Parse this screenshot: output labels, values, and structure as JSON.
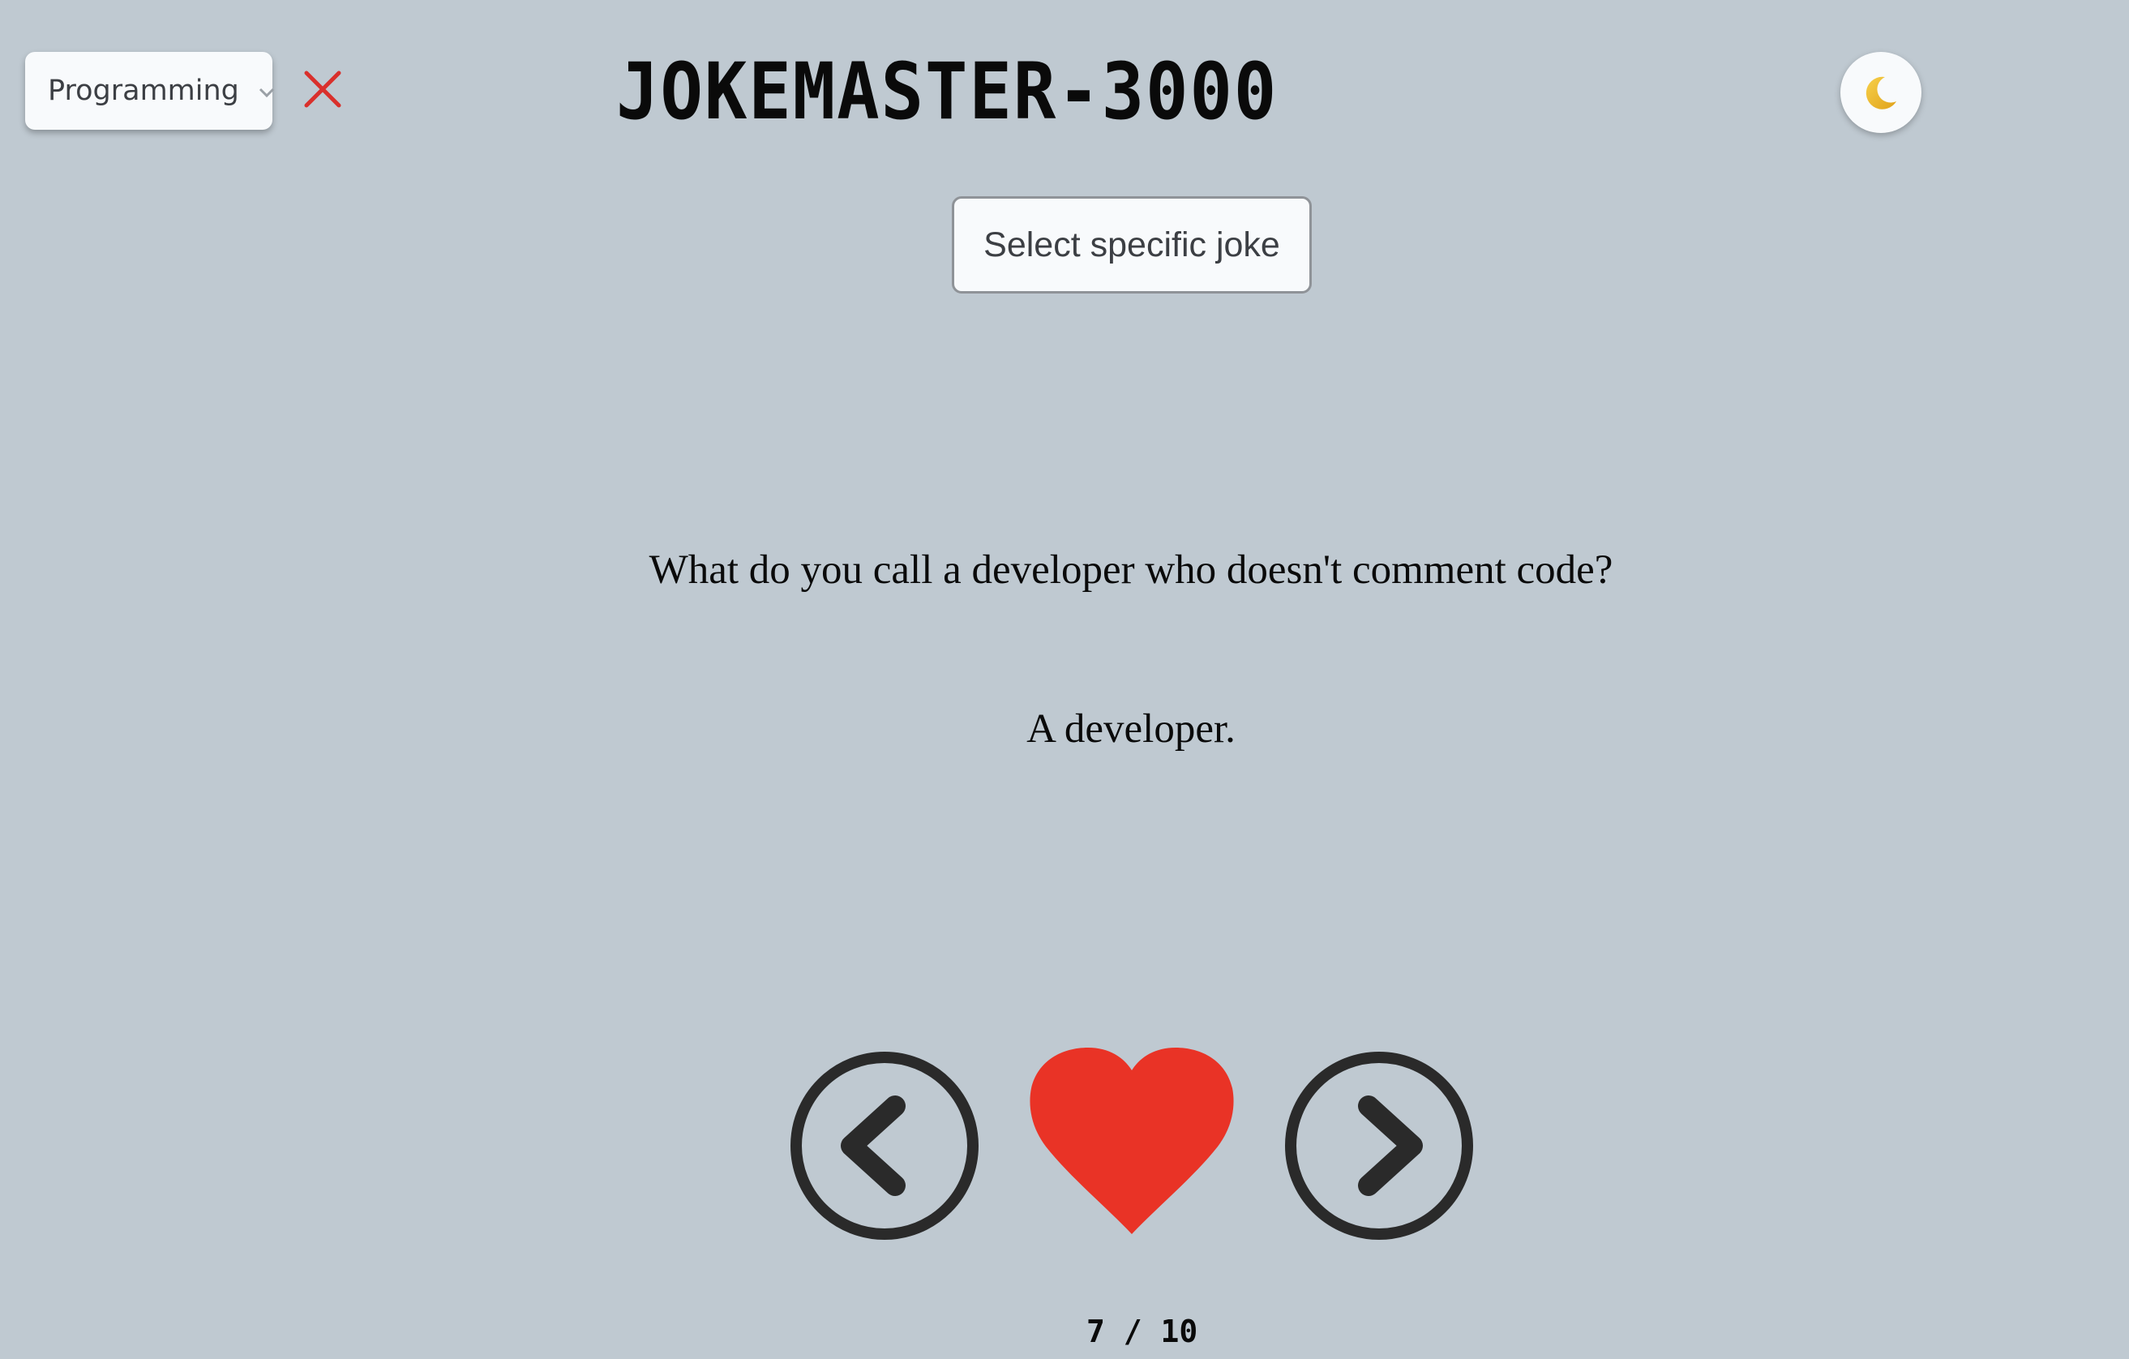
{
  "header": {
    "category": {
      "selected": "Programming",
      "icon": "chevron-down-icon"
    },
    "clear_icon": "close-icon",
    "title": "JOKEMASTER-3000",
    "theme_icon": "moon-icon"
  },
  "controls": {
    "select_joke_label": "Select specific joke"
  },
  "joke": {
    "setup": "What do you call a developer who doesn't comment code?",
    "punchline": "A developer."
  },
  "navigation": {
    "prev_icon": "chevron-left-circle-icon",
    "favorite_icon": "heart-icon",
    "next_icon": "chevron-right-circle-icon",
    "counter": "7 / 10"
  },
  "colors": {
    "background": "#bfc9d1",
    "heart": "#e93326",
    "close": "#d9302c",
    "nav_stroke": "#2a2a2a"
  }
}
